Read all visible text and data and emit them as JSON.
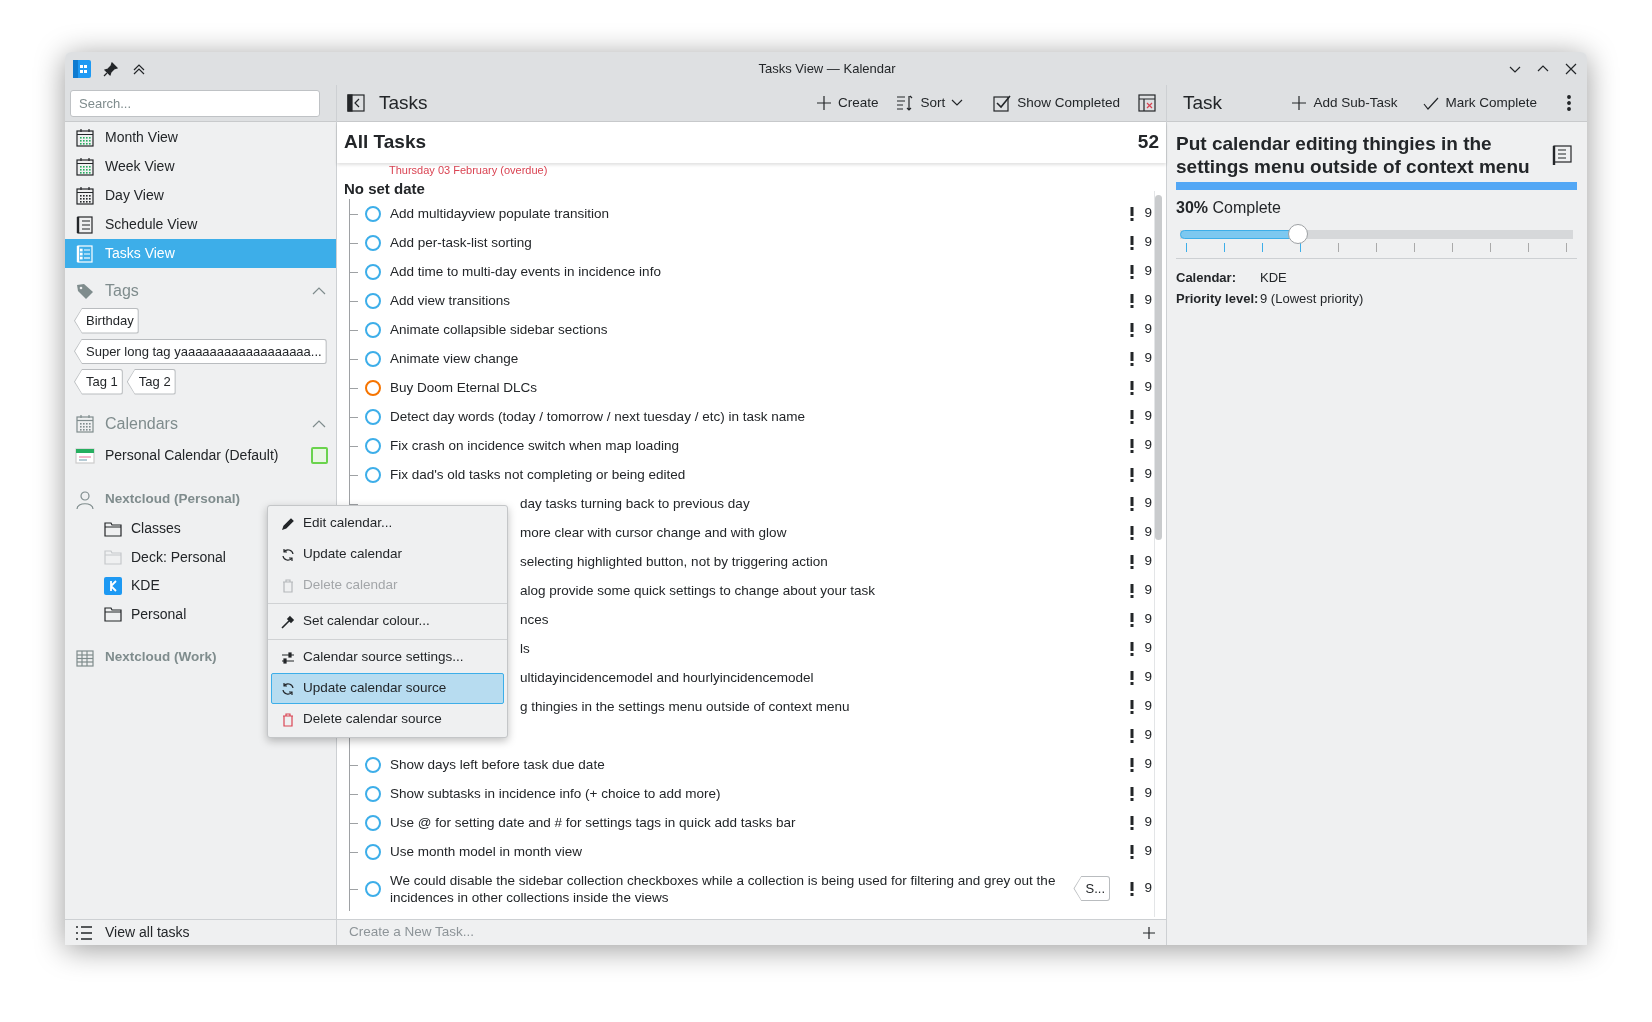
{
  "window": {
    "title": "Tasks View — Kalendar"
  },
  "sidebar": {
    "search": {
      "placeholder": "Search..."
    },
    "views": [
      {
        "label": "Month View",
        "kind": "month",
        "selected": false
      },
      {
        "label": "Week View",
        "kind": "week",
        "selected": false
      },
      {
        "label": "Day View",
        "kind": "day",
        "selected": false
      },
      {
        "label": "Schedule View",
        "kind": "schedule",
        "selected": false
      },
      {
        "label": "Tasks View",
        "kind": "tasks",
        "selected": true
      }
    ],
    "tags_section": {
      "title": "Tags",
      "expanded": true,
      "tags": [
        "Birthday",
        "Super long tag yaaaaaaaaaaaaaaaaaa...",
        "Tag 1",
        "Tag 2"
      ]
    },
    "calendars_section": {
      "title": "Calendars",
      "expanded": true,
      "calendars": [
        {
          "name": "Personal Calendar (Default)",
          "checked": false,
          "color": "#6ad34d"
        }
      ]
    },
    "sources": [
      {
        "name": "Nextcloud (Personal)",
        "kind": "account",
        "children": [
          {
            "name": "Classes",
            "kind": "folder"
          },
          {
            "name": "Deck: Personal",
            "kind": "faded"
          },
          {
            "name": "KDE",
            "kind": "kde"
          },
          {
            "name": "Personal",
            "kind": "folder"
          }
        ]
      },
      {
        "name": "Nextcloud (Work)",
        "kind": "grid"
      }
    ],
    "footer": {
      "label": "View all tasks"
    }
  },
  "tasks": {
    "title": "Tasks",
    "toolbar": [
      {
        "label": "Create",
        "kind": "plus"
      },
      {
        "label": "Sort",
        "kind": "sort"
      },
      {
        "label": "Show Completed",
        "kind": "check"
      }
    ],
    "header": {
      "title": "All Tasks",
      "count": "52"
    },
    "overdue_date": "Thursday 03 February (overdue)",
    "group": "No set date",
    "rows": [
      {
        "kind": "full",
        "title": "Add multidayview populate transition",
        "color": "#3daee9",
        "priority": "9"
      },
      {
        "kind": "full",
        "title": "Add per-task-list sorting",
        "color": "#3daee9",
        "priority": "9"
      },
      {
        "kind": "full",
        "title": "Add time to multi-day events in incidence info",
        "color": "#3daee9",
        "priority": "9"
      },
      {
        "kind": "full",
        "title": "Add view transitions",
        "color": "#3daee9",
        "priority": "9"
      },
      {
        "kind": "full",
        "title": "Animate collapsible sidebar sections",
        "color": "#3daee9",
        "priority": "9"
      },
      {
        "kind": "full",
        "title": "Animate view change",
        "color": "#3daee9",
        "priority": "9"
      },
      {
        "kind": "full",
        "title": "Buy Doom Eternal DLCs",
        "color": "#f67400",
        "priority": "9"
      },
      {
        "kind": "full",
        "title": "Detect day words (today / tomorrow / next tuesday / etc) in task name",
        "color": "#3daee9",
        "priority": "9"
      },
      {
        "kind": "full",
        "title": "Fix crash on incidence switch when map loading",
        "color": "#3daee9",
        "priority": "9"
      },
      {
        "kind": "full",
        "title": "Fix dad's old tasks not completing or being edited",
        "color": "#3daee9",
        "priority": "9"
      },
      {
        "kind": "covered",
        "title": "day tasks turning back to previous day",
        "priority": "9"
      },
      {
        "kind": "covered",
        "title": "more clear with cursor change and with glow",
        "priority": "9"
      },
      {
        "kind": "covered",
        "title": "selecting highlighted button, not by triggering action",
        "priority": "9"
      },
      {
        "kind": "covered",
        "title": "alog provide some quick settings to change about your task",
        "priority": "9"
      },
      {
        "kind": "covered",
        "title": "nces",
        "priority": "9"
      },
      {
        "kind": "covered",
        "title": "ls",
        "priority": "9"
      },
      {
        "kind": "covered",
        "title": "ultidayincidencemodel and hourlyincidencemodel",
        "priority": "9"
      },
      {
        "kind": "covered",
        "title": "g thingies in the settings menu outside of context menu",
        "priority": "9"
      },
      {
        "kind": "covered",
        "priority": "9"
      },
      {
        "kind": "full",
        "title": "Show days left before task due date",
        "color": "#3daee9",
        "priority": "9"
      },
      {
        "kind": "full",
        "title": "Show subtasks in incidence info (+ choice to add more)",
        "color": "#3daee9",
        "priority": "9"
      },
      {
        "kind": "full",
        "title": "Use @ for setting date and # for settings tags in quick add tasks bar",
        "color": "#3daee9",
        "priority": "9"
      },
      {
        "kind": "full",
        "title": "Use month model in month view",
        "color": "#3daee9",
        "priority": "9"
      },
      {
        "kind": "full",
        "title": "We could disable the sidebar collection checkboxes while a collection is being used for filtering and grey out the incidences in other collections inside the views",
        "color": "#3daee9",
        "priority": "9",
        "tags": [
          "S..."
        ]
      }
    ],
    "new_task": {
      "placeholder": "Create a New Task..."
    }
  },
  "context_menu": {
    "items": [
      {
        "kind": "edit",
        "label": "Edit calendar...",
        "disabled": false,
        "selected": false
      },
      {
        "kind": "refresh",
        "label": "Update calendar",
        "disabled": false,
        "selected": false
      },
      {
        "kind": "delete",
        "label": "Delete calendar",
        "disabled": true,
        "selected": false
      },
      {
        "kind": "separator"
      },
      {
        "kind": "color",
        "label": "Set calendar colour...",
        "disabled": false,
        "selected": false
      },
      {
        "kind": "separator"
      },
      {
        "kind": "settings",
        "label": "Calendar source settings...",
        "disabled": false,
        "selected": false
      },
      {
        "kind": "refresh",
        "label": "Update calendar source",
        "disabled": false,
        "selected": true
      },
      {
        "kind": "delete",
        "label": "Delete calendar source",
        "disabled": false,
        "selected": false
      }
    ]
  },
  "task_detail": {
    "title": "Task",
    "actions": [
      {
        "label": "Add Sub-Task",
        "kind": "plus"
      },
      {
        "label": "Mark Complete",
        "kind": "check"
      }
    ],
    "name": "Put calendar editing thingies in the settings menu outside of context menu",
    "completion": "**30%** Complete",
    "level": 0.3,
    "fields": [
      {
        "label": "Calendar:",
        "value": "KDE"
      },
      {
        "label": "Priority level:",
        "value": "9 (Lowest priority)"
      }
    ]
  }
}
